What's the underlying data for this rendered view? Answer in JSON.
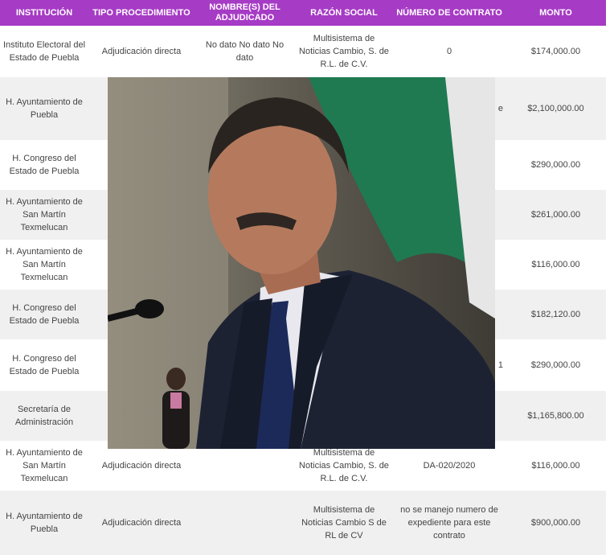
{
  "headers": [
    "INSTITUCIÓN",
    "TIPO PROCEDIMIENTO",
    "NOMBRE(S) DEL ADJUDICADO",
    "RAZÓN SOCIAL",
    "NÚMERO DE CONTRATO",
    "MONTO"
  ],
  "rows": [
    {
      "institucion": "Instituto Electoral del Estado de Puebla",
      "tipo": "Adjudicación directa",
      "nombre": "No dato No dato No dato",
      "razon": "Multisistema de Noticias Cambio, S. de R.L. de C.V.",
      "contrato": "0",
      "monto": "$174,000.00"
    },
    {
      "institucion": "H. Ayuntamiento de Puebla",
      "tipo": "",
      "nombre": "",
      "razon": "",
      "contrato": "e",
      "monto": "$2,100,000.00"
    },
    {
      "institucion": "H. Congreso del Estado de Puebla",
      "tipo": "",
      "nombre": "",
      "razon": "",
      "contrato": "",
      "monto": "$290,000.00"
    },
    {
      "institucion": "H. Ayuntamiento de San Martín Texmelucan",
      "tipo": "",
      "nombre": "",
      "razon": "",
      "contrato": "",
      "monto": "$261,000.00"
    },
    {
      "institucion": "H. Ayuntamiento de San Martín Texmelucan",
      "tipo": "",
      "nombre": "",
      "razon": "",
      "contrato": "",
      "monto": "$116,000.00"
    },
    {
      "institucion": "H. Congreso del Estado de Puebla",
      "tipo": "",
      "nombre": "",
      "razon": "",
      "contrato": "",
      "monto": "$182,120.00"
    },
    {
      "institucion": "H. Congreso del Estado de Puebla",
      "tipo": "",
      "nombre": "",
      "razon": "",
      "contrato": "1",
      "monto": "$290,000.00"
    },
    {
      "institucion": "Secretaría de Administración",
      "tipo": "",
      "nombre": "",
      "razon": "",
      "contrato": "",
      "monto": "$1,165,800.00"
    },
    {
      "institucion": "H. Ayuntamiento de San Martín Texmelucan",
      "tipo": "Adjudicación directa",
      "nombre": "",
      "razon": "Multisistema de Noticias Cambio, S. de R.L. de C.V.",
      "contrato": "DA-020/2020",
      "monto": "$116,000.00"
    },
    {
      "institucion": "H. Ayuntamiento de Puebla",
      "tipo": "Adjudicación directa",
      "nombre": "",
      "razon": "Multisistema de Noticias Cambio S de RL de CV",
      "contrato": "no se manejo numero de expediente para este contrato",
      "monto": "$900,000.00"
    }
  ]
}
